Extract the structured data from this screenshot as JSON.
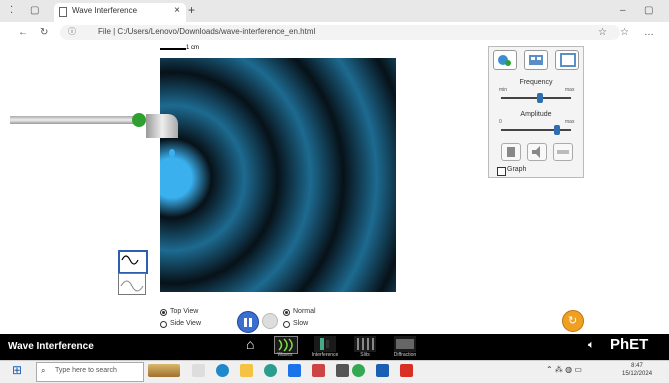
{
  "browser": {
    "tab_title": "Wave Interference",
    "tab_close": "×",
    "new_tab": "+",
    "url": "File | C:/Users/Lenovo/Downloads/wave-interference_en.html",
    "url_info": "ⓘ"
  },
  "sim": {
    "scale_label": "1 cm",
    "panel": {
      "frequency_label": "Frequency",
      "frequency_min": "min",
      "frequency_max": "max",
      "frequency_level": 0.55,
      "amplitude_label": "Amplitude",
      "amplitude_min": "0",
      "amplitude_max": "max",
      "amplitude_level": 0.8,
      "graph_label": "Graph"
    },
    "views": {
      "top_view": "Top View",
      "side_view": "Side View",
      "speed_normal": "Normal",
      "speed_slow": "Slow"
    },
    "colors": {
      "wave_light": "#3ab0ee",
      "wave_dark": "#071118"
    }
  },
  "nav": {
    "sim_title": "Wave Interference",
    "screens": [
      "Waves",
      "Interference",
      "Slits",
      "Diffraction"
    ],
    "brand": "PhET"
  },
  "taskbar": {
    "search_placeholder": "Type here to search",
    "time": "8:47",
    "date": "15/12/2024"
  }
}
